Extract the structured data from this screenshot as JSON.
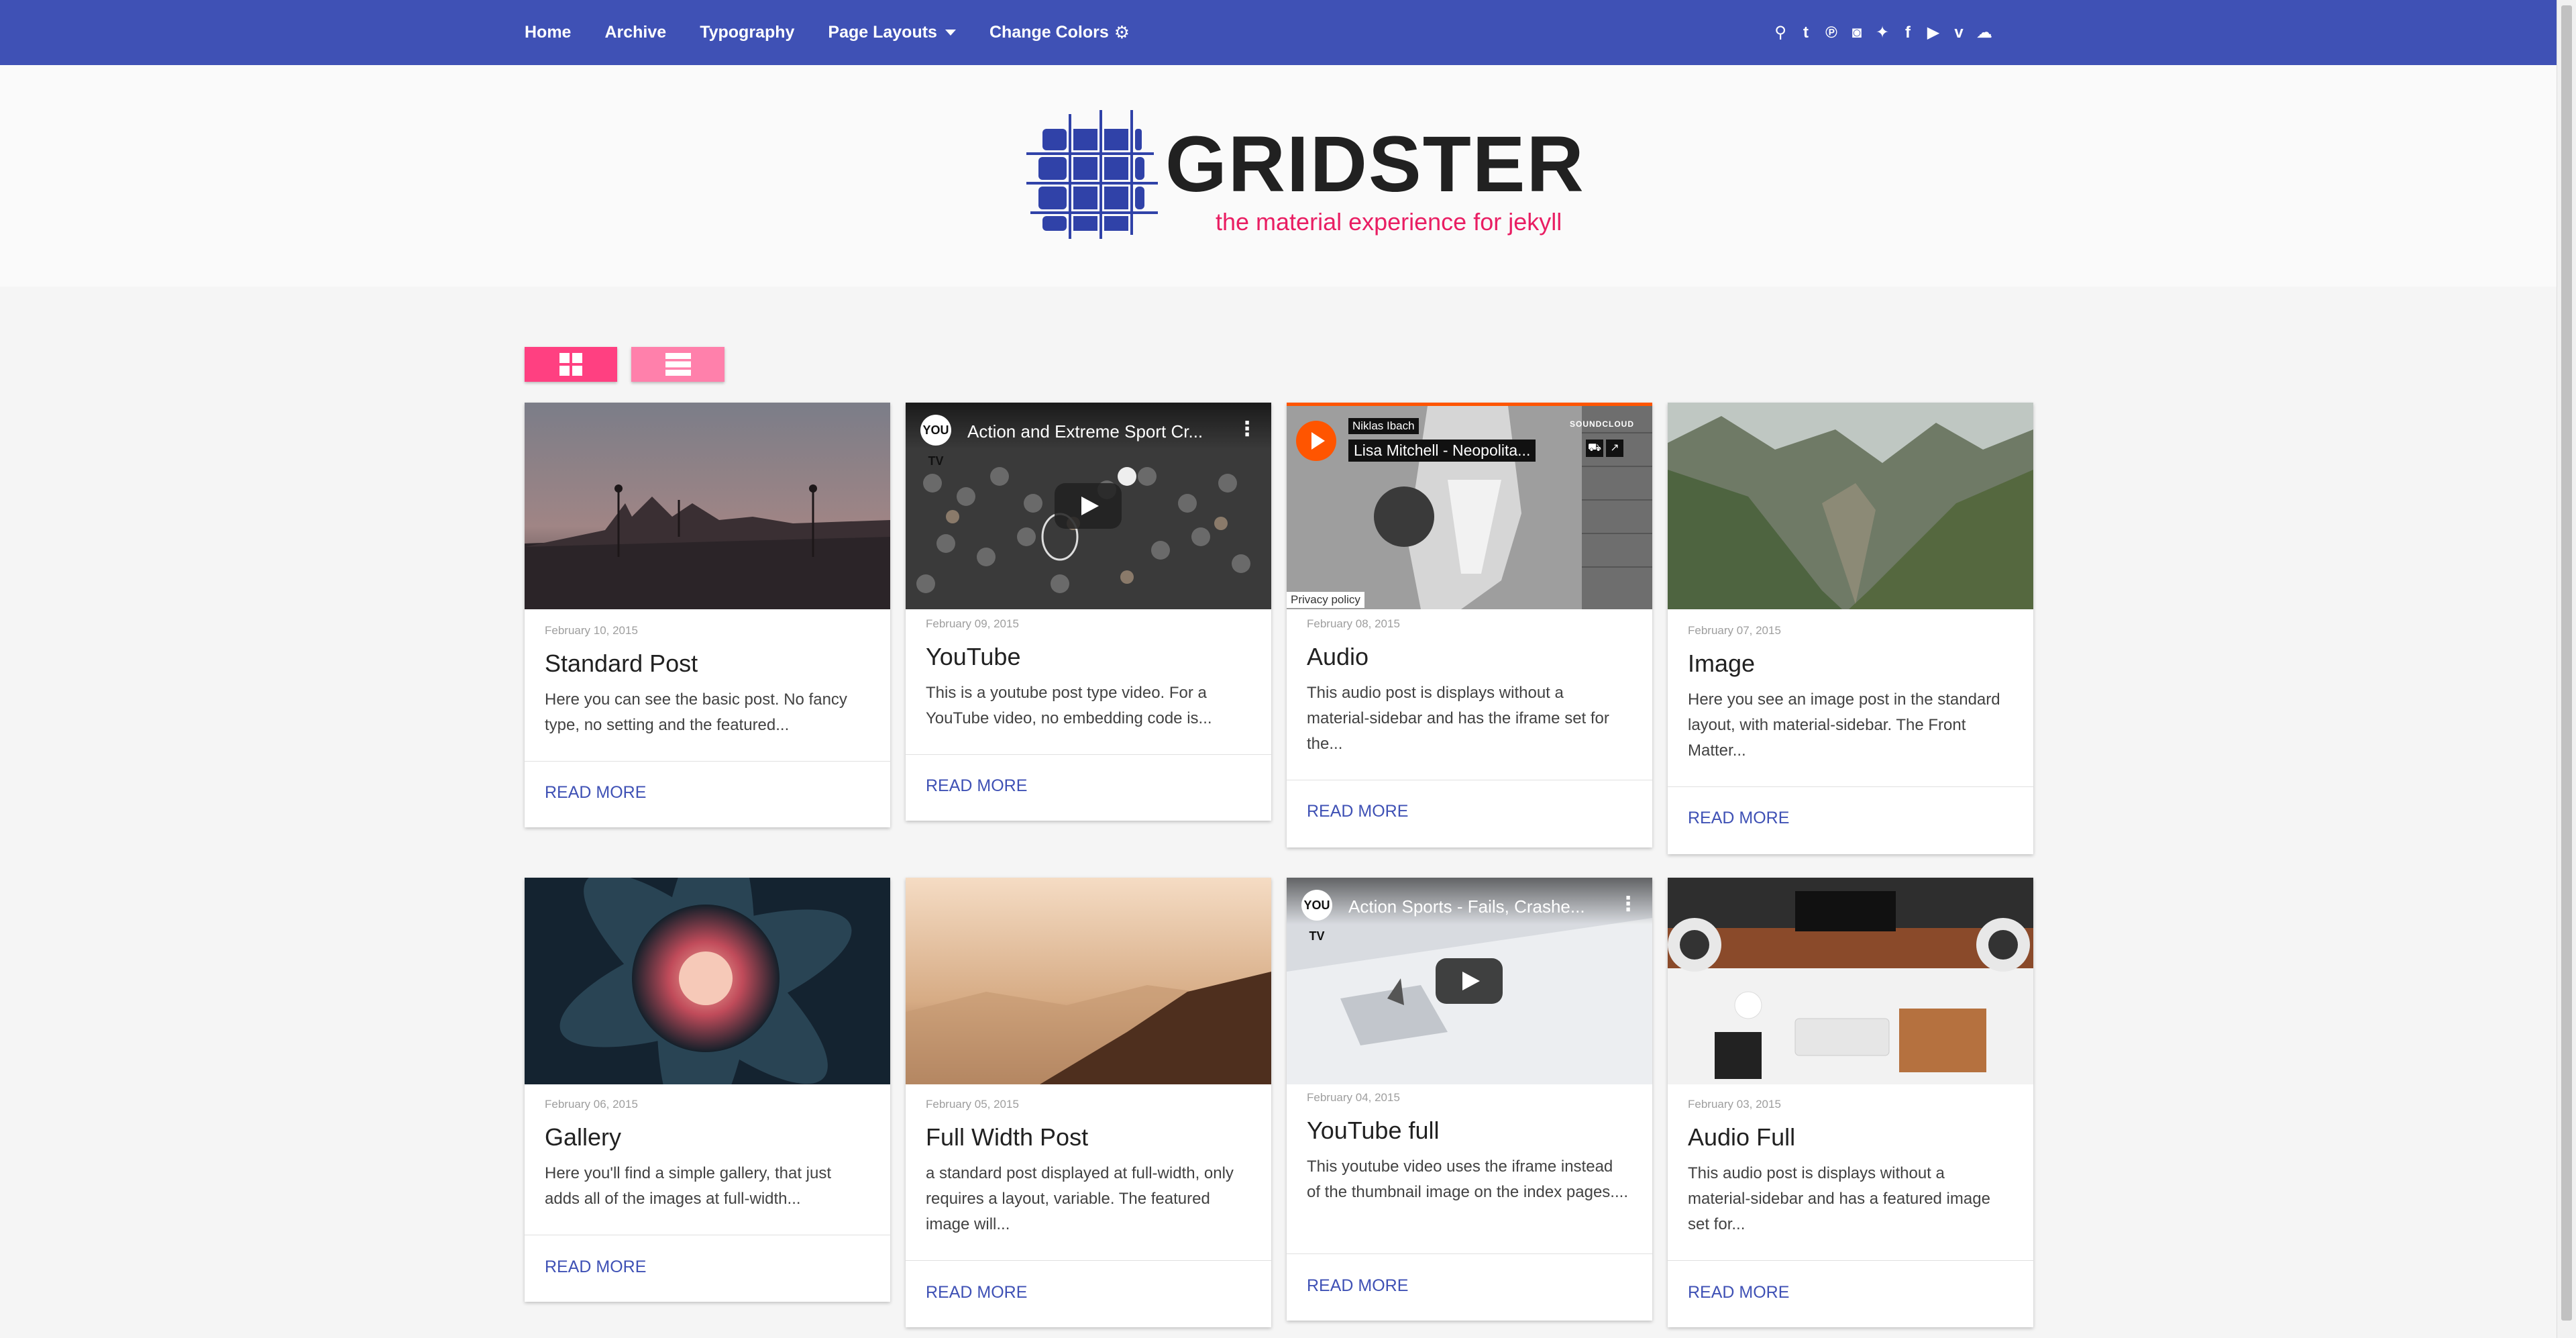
{
  "nav": {
    "items": [
      "Home",
      "Archive",
      "Typography",
      "Page Layouts",
      "Change Colors"
    ],
    "social": [
      "search-icon",
      "tumblr-icon",
      "pinterest-icon",
      "instagram-icon",
      "twitter-icon",
      "facebook-icon",
      "youtube-icon",
      "vimeo-icon",
      "soundcloud-icon"
    ],
    "social_glyphs": [
      "⚲",
      "t",
      "℗",
      "◙",
      "✦",
      "f",
      "▶",
      "v",
      "☁"
    ]
  },
  "logo": {
    "word": "GRIDSTER",
    "tagline": "the material experience for jekyll"
  },
  "colors": {
    "primary": "#3f51b5",
    "accent": "#e91e63",
    "toggle_active": "#ff4081",
    "toggle_inactive": "#ff80ab"
  },
  "cards": [
    {
      "date": "February 10, 2015",
      "title": "Standard Post",
      "excerpt": "Here you can see the basic post. No fancy type, no setting and the featured...",
      "more": "READ MORE"
    },
    {
      "date": "February 09, 2015",
      "title": "YouTube",
      "excerpt": "This is a youtube post type video. For a YouTube video, no embedding code is...",
      "more": "READ MORE",
      "embed_title": "Action and Extreme Sport Cr...",
      "embed_logo": "YOU TV"
    },
    {
      "date": "February 08, 2015",
      "title": "Audio",
      "excerpt": "This audio post is displays without a material-sidebar and has the iframe set for the...",
      "more": "READ MORE",
      "player_artist": "Niklas Ibach",
      "player_track": "Lisa Mitchell - Neopolita...",
      "player_brand": "SOUNDCLOUD",
      "player_privacy": "Privacy policy"
    },
    {
      "date": "February 07, 2015",
      "title": "Image",
      "excerpt": "Here you see an image post in the standard layout, with material-sidebar. The Front Matter...",
      "more": "READ MORE"
    },
    {
      "date": "February 06, 2015",
      "title": "Gallery",
      "excerpt": "Here you'll find a simple gallery, that just adds all of the images at full-width...",
      "more": "READ MORE"
    },
    {
      "date": "February 05, 2015",
      "title": "Full Width Post",
      "excerpt": "a standard post displayed at full-width, only requires a layout, variable. The featured image will...",
      "more": "READ MORE"
    },
    {
      "date": "February 04, 2015",
      "title": "YouTube full",
      "excerpt": "This youtube video uses the iframe instead of the thumbnail image on the index pages....",
      "more": "READ MORE",
      "embed_title": "Action Sports - Fails, Crashe...",
      "embed_logo": "YOU TV"
    },
    {
      "date": "February 03, 2015",
      "title": "Audio Full",
      "excerpt": "This audio post is displays without a material-sidebar and has a featured image set for...",
      "more": "READ MORE"
    }
  ]
}
